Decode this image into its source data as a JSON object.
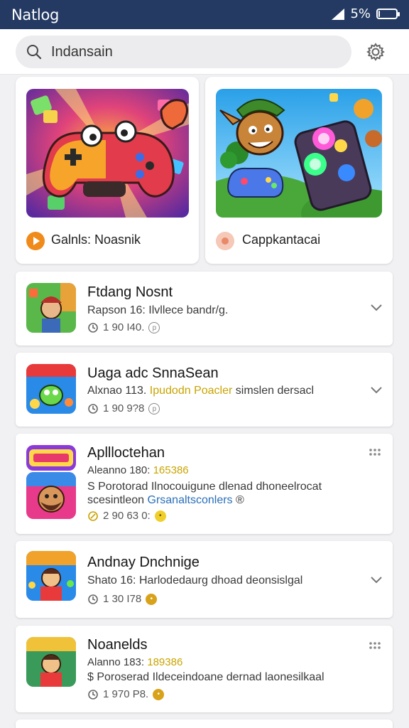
{
  "status_bar": {
    "title": "Natlog",
    "battery": "5%",
    "battery_level": 0.05
  },
  "search": {
    "value": "Indansain"
  },
  "featured": [
    {
      "label": "Galnls: Noasnik",
      "icon": "controller-art"
    },
    {
      "label": "Cappkantacai",
      "icon": "goblin-art"
    }
  ],
  "list": [
    {
      "name": "Ftdang Nosnt",
      "sub": "Rapson 16: Ilvllece bandr/g.",
      "meta": "1 90 I40.",
      "icon": "chevron-down-icon",
      "meta_icon": "clock-icon"
    },
    {
      "name": "Uaga adc SnnaSean",
      "sub_prefix": "Alxnao 113.",
      "sub_highlight": "Ipudodn Poacler",
      "sub_suffix": "simslen dersacl",
      "meta": "1 90 9?8",
      "icon": "chevron-down-icon",
      "meta_icon": "clock-icon"
    },
    {
      "name": "Apllloctehan",
      "sub_prefix": "Aleanno 180:",
      "sub_highlight": "165386",
      "desc1": "S Porotorad Ilnocouigune dlenad dhoneelrocat",
      "desc2_prefix": "scesintleon",
      "desc2_link": "Grsanaltsconlers",
      "desc2_suffix": "®",
      "meta": "2 90 63 0:",
      "icon": "more-dots-icon",
      "meta_icon": "rocket-icon"
    },
    {
      "name": "Andnay Dnchnige",
      "sub": "Shato 16: Harlodedaurg dhoad deonsislgal",
      "meta": "1 30 I78",
      "icon": "chevron-down-icon",
      "meta_icon": "clock-icon"
    },
    {
      "name": "Noanelds",
      "sub_prefix": "Alanno 183:",
      "sub_highlight": "189386",
      "desc1": "$ Poroserad Ildeceindoane dernad laonesilkaal",
      "meta": "1 970 P8.",
      "icon": "more-dots-icon",
      "meta_icon": "clock-icon"
    }
  ],
  "colors": {
    "status_bg": "#243a63",
    "highlight": "#c9a400",
    "link": "#2a6fb8"
  }
}
